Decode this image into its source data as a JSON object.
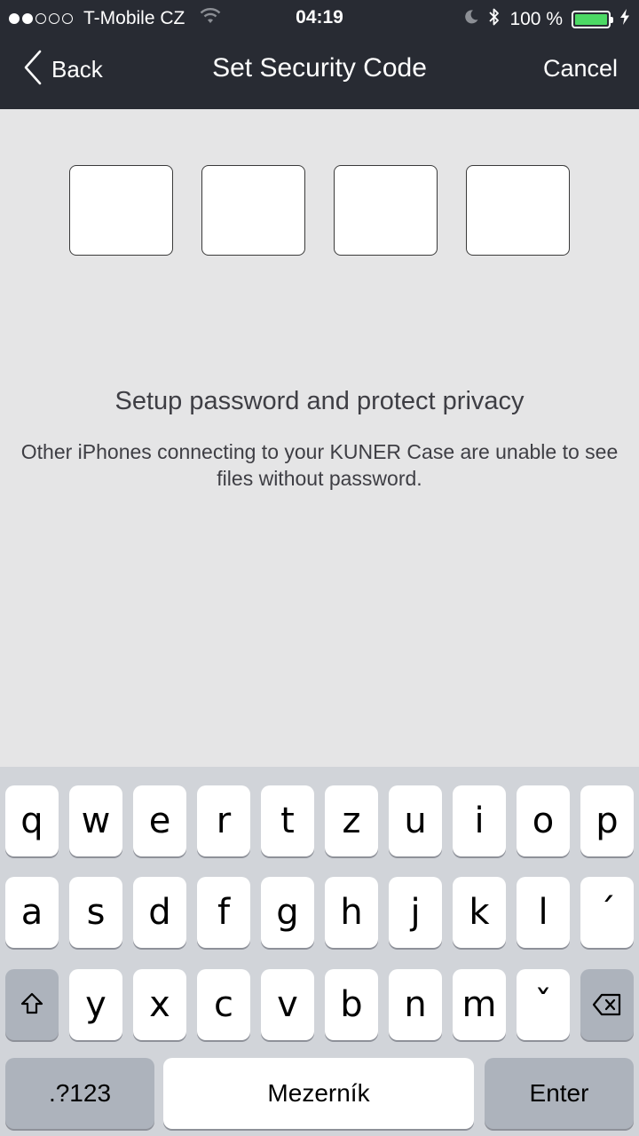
{
  "status_bar": {
    "carrier": "T-Mobile CZ",
    "time": "04:19",
    "battery": "100 %",
    "signal_full": 2,
    "signal_total": 5
  },
  "nav": {
    "back_label": "Back",
    "title": "Set Security Code",
    "cancel_label": "Cancel"
  },
  "code": {
    "digits": [
      "",
      "",
      "",
      ""
    ]
  },
  "content": {
    "headline": "Setup password and protect privacy",
    "description": "Other iPhones connecting to your KUNER Case are unable to see files without password."
  },
  "keyboard": {
    "row1": [
      "q",
      "w",
      "e",
      "r",
      "t",
      "z",
      "u",
      "i",
      "o",
      "p"
    ],
    "row2": [
      "a",
      "s",
      "d",
      "f",
      "g",
      "h",
      "j",
      "k",
      "l",
      "´"
    ],
    "row3": [
      "y",
      "x",
      "c",
      "v",
      "b",
      "n",
      "m",
      "ˇ"
    ],
    "numbers_label": ".?123",
    "space_label": "Mezerník",
    "enter_label": "Enter"
  },
  "colors": {
    "header_bg": "#282b33",
    "page_bg": "#e5e5e6",
    "battery_fill": "#4cd964",
    "keyboard_bg": "#d1d4d9"
  }
}
